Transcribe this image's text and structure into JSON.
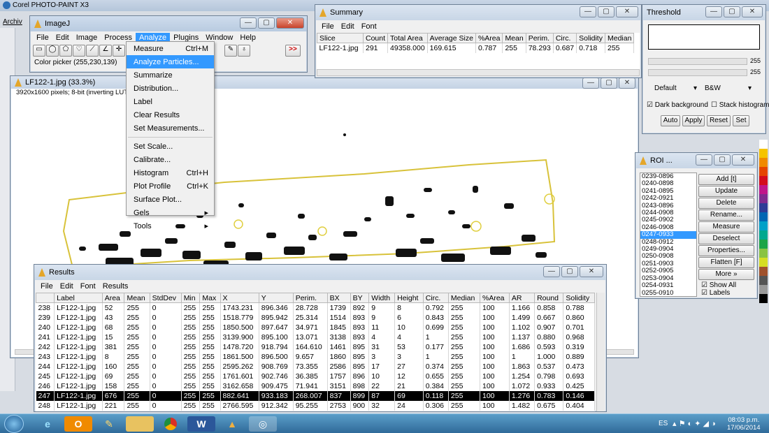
{
  "corel": {
    "title": "Corel PHOTO-PAINT X3",
    "menu_first": "Archiv"
  },
  "imagej": {
    "title": "ImageJ",
    "menu": [
      "File",
      "Edit",
      "Image",
      "Process",
      "Analyze",
      "Plugins",
      "Window",
      "Help"
    ],
    "status": "Color picker (255,230,139)",
    "more": ">>"
  },
  "analyze_menu": {
    "items": [
      {
        "label": "Measure",
        "shortcut": "Ctrl+M"
      },
      {
        "label": "Analyze Particles...",
        "shortcut": ""
      },
      {
        "label": "Summarize",
        "shortcut": ""
      },
      {
        "label": "Distribution...",
        "shortcut": ""
      },
      {
        "label": "Label",
        "shortcut": ""
      },
      {
        "label": "Clear Results",
        "shortcut": ""
      },
      {
        "label": "Set Measurements...",
        "shortcut": ""
      },
      {
        "label": "Set Scale...",
        "shortcut": ""
      },
      {
        "label": "Calibrate...",
        "shortcut": ""
      },
      {
        "label": "Histogram",
        "shortcut": "Ctrl+H"
      },
      {
        "label": "Plot Profile",
        "shortcut": "Ctrl+K"
      },
      {
        "label": "Surface Plot...",
        "shortcut": ""
      },
      {
        "label": "Gels",
        "shortcut": "▸"
      },
      {
        "label": "Tools",
        "shortcut": "▸"
      }
    ]
  },
  "image_window": {
    "title": "LF122-1.jpg (33.3%)",
    "info": "3920x1600 pixels; 8-bit (inverting LUT); 6M"
  },
  "summary": {
    "title": "Summary",
    "menu": [
      "File",
      "Edit",
      "Font"
    ],
    "headers": [
      "Slice",
      "Count",
      "Total Area",
      "Average Size",
      "%Area",
      "Mean",
      "Perim.",
      "Circ.",
      "Solidity",
      "Median"
    ],
    "row": [
      "LF122-1.jpg",
      "291",
      "49358.000",
      "169.615",
      "0.787",
      "255",
      "78.293",
      "0.687",
      "0.718",
      "255"
    ]
  },
  "threshold": {
    "title": "Threshold",
    "value1": "255",
    "value2": "255",
    "method": "Default",
    "mode": "B&W",
    "dark_background": "Dark background",
    "stack_histogram": "Stack histogram",
    "buttons": [
      "Auto",
      "Apply",
      "Reset",
      "Set"
    ]
  },
  "roi": {
    "title": "ROI ...",
    "items": [
      "0239-0896",
      "0240-0898",
      "0241-0895",
      "0242-0921",
      "0243-0896",
      "0244-0908",
      "0245-0902",
      "0246-0908",
      "0247-0933",
      "0248-0912",
      "0249-0904",
      "0250-0908",
      "0251-0903",
      "0252-0905",
      "0253-0904",
      "0254-0931",
      "0255-0910"
    ],
    "selected_index": 8,
    "buttons": [
      "Add [t]",
      "Update",
      "Delete",
      "Rename...",
      "Measure",
      "Deselect",
      "Properties...",
      "Flatten [F]",
      "More »"
    ],
    "show_all": "Show All",
    "labels": "Labels"
  },
  "results": {
    "title": "Results",
    "menu": [
      "File",
      "Edit",
      "Font",
      "Results"
    ],
    "headers": [
      "",
      "Label",
      "Area",
      "Mean",
      "StdDev",
      "Min",
      "Max",
      "X",
      "Y",
      "Perim.",
      "BX",
      "BY",
      "Width",
      "Height",
      "Circ.",
      "Median",
      "%Area",
      "AR",
      "Round",
      "Solidity"
    ],
    "rows": [
      [
        "238",
        "LF122-1.jpg",
        "52",
        "255",
        "0",
        "255",
        "255",
        "1743.231",
        "896.346",
        "28.728",
        "1739",
        "892",
        "9",
        "8",
        "0.792",
        "255",
        "100",
        "1.166",
        "0.858",
        "0.788"
      ],
      [
        "239",
        "LF122-1.jpg",
        "43",
        "255",
        "0",
        "255",
        "255",
        "1518.779",
        "895.942",
        "25.314",
        "1514",
        "893",
        "9",
        "6",
        "0.843",
        "255",
        "100",
        "1.499",
        "0.667",
        "0.860"
      ],
      [
        "240",
        "LF122-1.jpg",
        "68",
        "255",
        "0",
        "255",
        "255",
        "1850.500",
        "897.647",
        "34.971",
        "1845",
        "893",
        "11",
        "10",
        "0.699",
        "255",
        "100",
        "1.102",
        "0.907",
        "0.701"
      ],
      [
        "241",
        "LF122-1.jpg",
        "15",
        "255",
        "0",
        "255",
        "255",
        "3139.900",
        "895.100",
        "13.071",
        "3138",
        "893",
        "4",
        "4",
        "1",
        "255",
        "100",
        "1.137",
        "0.880",
        "0.968"
      ],
      [
        "242",
        "LF122-1.jpg",
        "381",
        "255",
        "0",
        "255",
        "255",
        "1478.720",
        "918.794",
        "164.610",
        "1461",
        "895",
        "31",
        "53",
        "0.177",
        "255",
        "100",
        "1.686",
        "0.593",
        "0.319"
      ],
      [
        "243",
        "LF122-1.jpg",
        "8",
        "255",
        "0",
        "255",
        "255",
        "1861.500",
        "896.500",
        "9.657",
        "1860",
        "895",
        "3",
        "3",
        "1",
        "255",
        "100",
        "1",
        "1.000",
        "0.889"
      ],
      [
        "244",
        "LF122-1.jpg",
        "160",
        "255",
        "0",
        "255",
        "255",
        "2595.262",
        "908.769",
        "73.355",
        "2586",
        "895",
        "17",
        "27",
        "0.374",
        "255",
        "100",
        "1.863",
        "0.537",
        "0.473"
      ],
      [
        "245",
        "LF122-1.jpg",
        "69",
        "255",
        "0",
        "255",
        "255",
        "1761.601",
        "902.746",
        "36.385",
        "1757",
        "896",
        "10",
        "12",
        "0.655",
        "255",
        "100",
        "1.254",
        "0.798",
        "0.693"
      ],
      [
        "246",
        "LF122-1.jpg",
        "158",
        "255",
        "0",
        "255",
        "255",
        "3162.658",
        "909.475",
        "71.941",
        "3151",
        "898",
        "22",
        "21",
        "0.384",
        "255",
        "100",
        "1.072",
        "0.933",
        "0.425"
      ],
      [
        "247",
        "LF122-1.jpg",
        "676",
        "255",
        "0",
        "255",
        "255",
        "882.641",
        "933.183",
        "268.007",
        "837",
        "899",
        "87",
        "69",
        "0.118",
        "255",
        "100",
        "1.276",
        "0.783",
        "0.146"
      ],
      [
        "248",
        "LF122-1.jpg",
        "221",
        "255",
        "0",
        "255",
        "255",
        "2766.595",
        "912.342",
        "95.255",
        "2753",
        "900",
        "32",
        "24",
        "0.306",
        "255",
        "100",
        "1.482",
        "0.675",
        "0.404"
      ]
    ],
    "selected_row": 9
  },
  "taskbar": {
    "lang": "ES",
    "time": "08:03 p.m.",
    "date": "17/06/2014"
  }
}
